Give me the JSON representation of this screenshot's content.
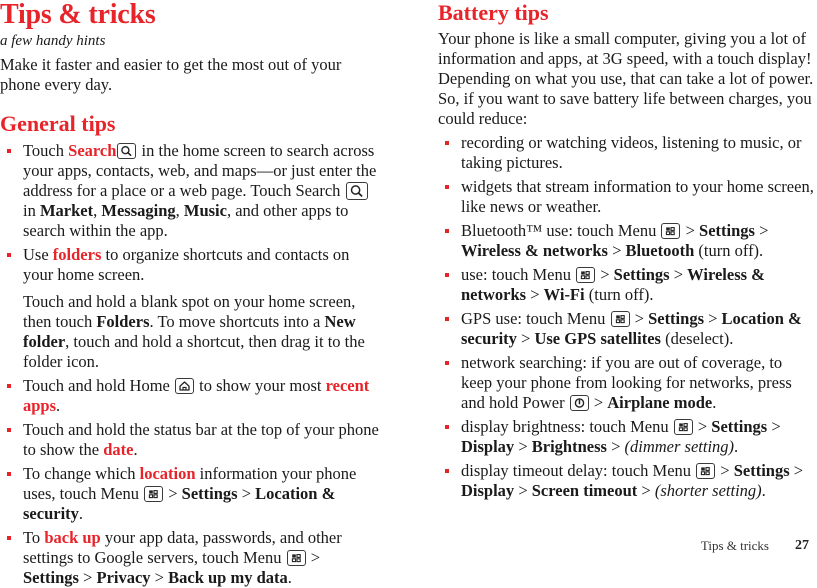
{
  "page": {
    "title": "Tips & tricks",
    "subtitle": "a few handy hints",
    "lead": "Make it faster and easier to get the most out of your phone every day.",
    "accent_color": "#e8232a",
    "text_color": "#1a1a1a",
    "background_color": "#ffffff"
  },
  "general_tips": {
    "heading": "General tips",
    "bullets": {
      "search": {
        "t1": "Touch ",
        "kw1": "Search",
        "icon1": "search-icon",
        "t2": " in the home screen to search across your apps, contacts, web, and maps—or just enter the address for a place or a web page. Touch Search ",
        "icon2": "search-icon",
        "t3": " in ",
        "app1": "Market",
        "sep1": ", ",
        "app2": "Messaging",
        "sep2": ", ",
        "app3": "Music",
        "t4": ", and other apps to search within the app."
      },
      "folders": {
        "t1": "Use ",
        "kw1": "folders",
        "t2": " to organize shortcuts and contacts on your home screen.",
        "sub_t1": "Touch and hold a blank spot on your home screen, then touch ",
        "sub_b1": "Folders",
        "sub_t2": ". To move shortcuts into a ",
        "sub_b2": "New folder",
        "sub_t3": ", touch and hold a shortcut, then drag it to the folder icon."
      },
      "home": {
        "t1": "Touch and hold Home ",
        "icon1": "home-icon",
        "t2": " to show your most ",
        "kw1": "recent apps",
        "t3": "."
      },
      "statusbar": {
        "t1": "Touch and hold the status bar at the top of your phone to show the ",
        "kw1": "date",
        "t2": "."
      },
      "location": {
        "t1": "To change which ",
        "kw1": "location",
        "t2": " information your phone uses, touch Menu ",
        "icon1": "menu-icon",
        "t3": " > ",
        "b1": "Settings",
        "t4": " > ",
        "b2": "Location & security",
        "t5": "."
      },
      "backup": {
        "t1": "To ",
        "kw1": "back up",
        "t2": " your app data, passwords, and other settings to Google servers, touch Menu ",
        "icon1": "menu-icon",
        "t3": " > ",
        "b1": "Settings",
        "t4": " > ",
        "b2": "Privacy",
        "t5": " > ",
        "b3": "Back up my data",
        "t6": "."
      }
    }
  },
  "battery_tips": {
    "heading": "Battery tips",
    "intro": "Your phone is like a small computer, giving you a lot of information and apps, at 3G speed, with a touch display! Depending on what you use, that can take a lot of power. So, if you want to save battery life between charges, you could reduce:",
    "bullets": {
      "media": {
        "t1": "recording or watching videos, listening to music, or taking pictures."
      },
      "widgets": {
        "t1": "widgets that stream information to your home screen, like news or weather."
      },
      "bluetooth": {
        "t1": "Bluetooth™ use: touch Menu ",
        "icon1": "menu-icon",
        "t2": " > ",
        "b1": "Settings",
        "t3": " > ",
        "b2": "Wireless & networks",
        "t4": " > ",
        "b3": "Bluetooth",
        "t5": " (turn off)."
      },
      "wifi": {
        "t1": " use: touch Menu ",
        "icon1": "menu-icon",
        "t2": " > ",
        "b1": "Settings",
        "t3": " > ",
        "b2": "Wireless & networks",
        "t4": " > ",
        "b3": "Wi-Fi",
        "t5": " (turn off)."
      },
      "gps": {
        "t1": "GPS use: touch Menu ",
        "icon1": "menu-icon",
        "t2": " > ",
        "b1": "Settings",
        "t3": " > ",
        "b2": "Location & security",
        "t4": " > ",
        "b3": "Use GPS satellites",
        "t5": " (deselect)."
      },
      "network": {
        "t1": "network searching: if you are out of coverage, to keep your phone from looking for networks, press and hold Power ",
        "icon1": "power-icon",
        "t2": " > ",
        "b1": "Airplane mode",
        "t3": "."
      },
      "brightness": {
        "t1": "display brightness: touch Menu ",
        "icon1": "menu-icon",
        "t2": " > ",
        "b1": "Settings",
        "t3": " > ",
        "b2": "Display",
        "t4": " > ",
        "b3": "Brightness",
        "t5": " > ",
        "i1": "(dimmer setting)",
        "t6": "."
      },
      "timeout": {
        "t1": "display timeout delay: touch Menu ",
        "icon1": "menu-icon",
        "t2": " > ",
        "b1": "Settings",
        "t3": " > ",
        "b2": "Display",
        "t4": " > ",
        "b3": "Screen timeout",
        "t5": " > ",
        "i1": "(shorter setting)",
        "t6": "."
      }
    }
  },
  "footer": {
    "title": "Tips & tricks",
    "page_number": "27"
  }
}
